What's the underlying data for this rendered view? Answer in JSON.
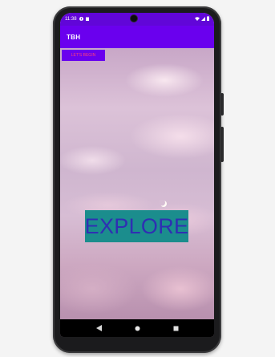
{
  "status_bar": {
    "time": "11:38",
    "alert_icon": "alert-icon",
    "notification_icon": "notification-icon",
    "wifi_icon": "wifi-icon",
    "signal_icon": "signal-icon",
    "battery_icon": "battery-icon"
  },
  "app_bar": {
    "title": "TBH"
  },
  "main": {
    "top_button_label": "LET'S BEGIN",
    "explore_button_label": "EXPLORE",
    "moon_icon": "crescent-moon-icon"
  },
  "nav_bar": {
    "back_icon": "back-icon",
    "home_icon": "home-icon",
    "recent_icon": "recent-apps-icon"
  },
  "colors": {
    "status_bar": "#6106d8",
    "app_bar": "#6a00ee",
    "top_button_text": "#ff3f7a",
    "explore_button_bg": "#1b8d8d",
    "explore_button_text": "#2f2fb3"
  }
}
